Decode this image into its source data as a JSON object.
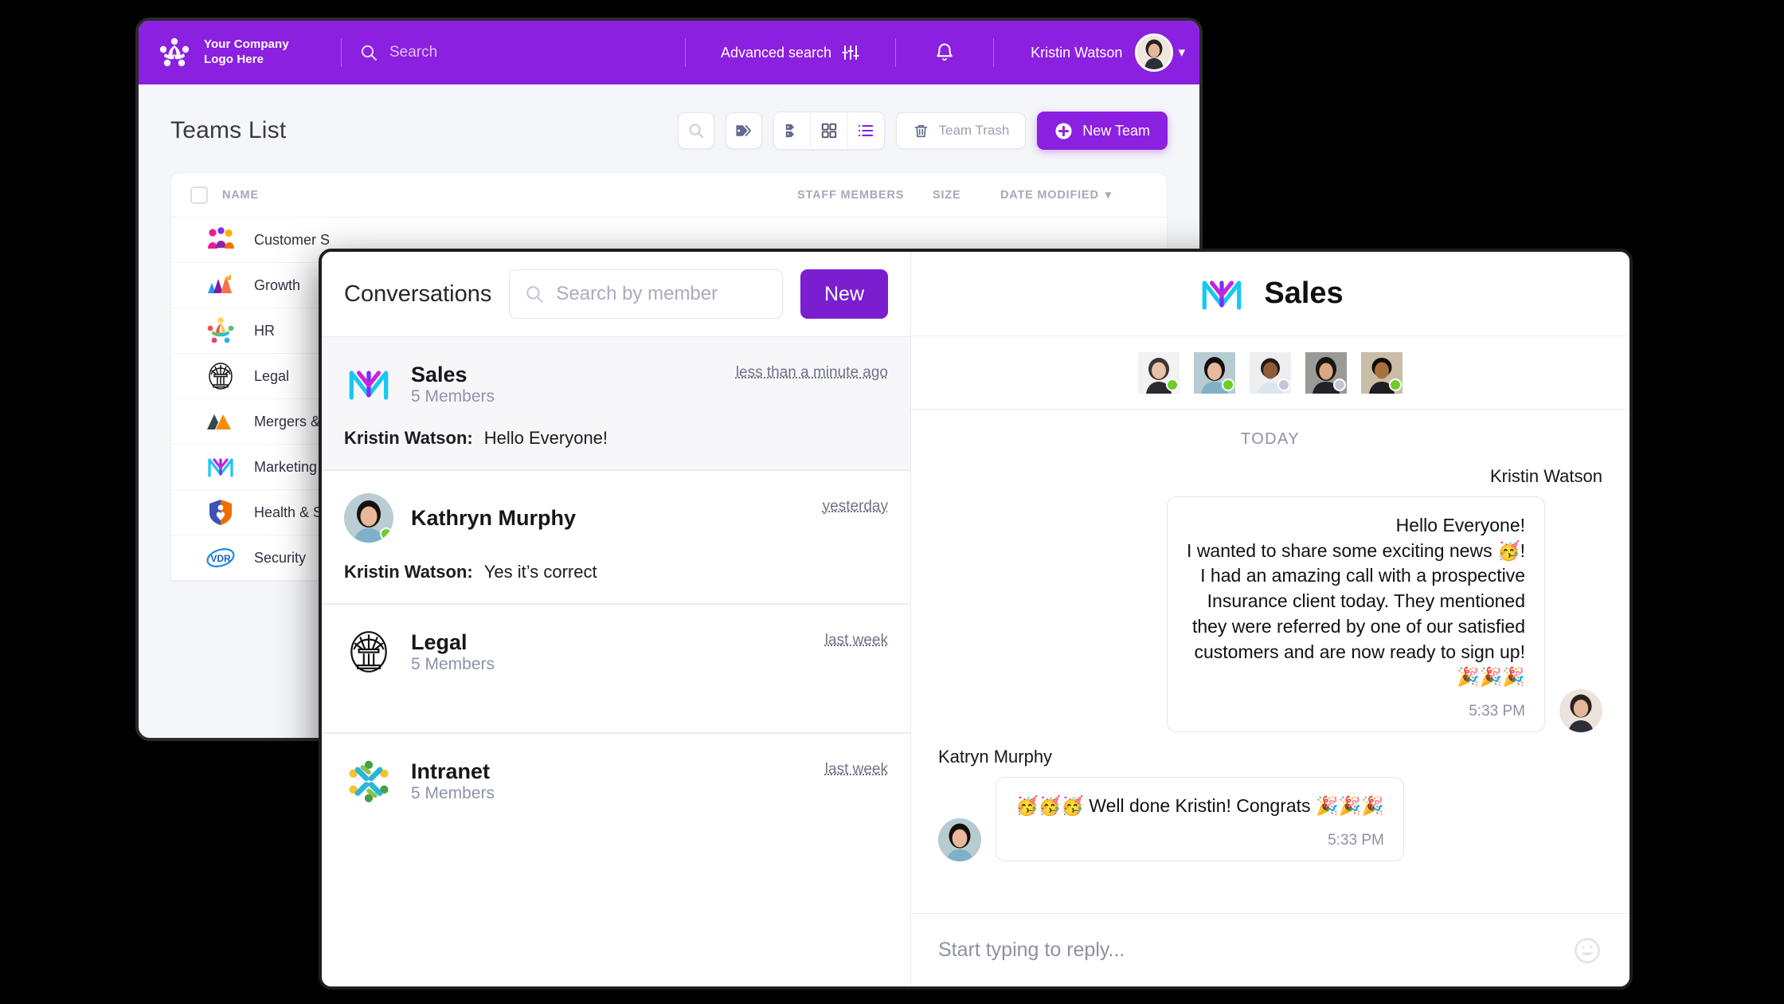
{
  "colors": {
    "brand_purple": "#8b20e0",
    "new_button_purple": "#7a1ed0",
    "online": "#6dcd2b",
    "offline": "#c5c8d4"
  },
  "app": {
    "topbar": {
      "brand_line1": "Your Company",
      "brand_line2": "Logo Here",
      "search_placeholder": "Search",
      "advanced_search_label": "Advanced search",
      "user_name": "Kristin Watson"
    },
    "page_title": "Teams List",
    "toolbar": {
      "team_trash_label": "Team Trash",
      "new_team_label": "New Team"
    },
    "table": {
      "columns": [
        "NAME",
        "STAFF MEMBERS",
        "SIZE",
        "DATE MODIFIED"
      ],
      "rows": [
        {
          "name": "Customer S"
        },
        {
          "name": "Growth"
        },
        {
          "name": "HR"
        },
        {
          "name": "Legal"
        },
        {
          "name": "Mergers & A"
        },
        {
          "name": "Marketing"
        },
        {
          "name": "Health & Sa"
        },
        {
          "name": "Security"
        }
      ]
    }
  },
  "conversations": {
    "title": "Conversations",
    "search_placeholder": "Search by member",
    "new_label": "New",
    "items": [
      {
        "name": "Sales",
        "sub": "5 Members",
        "time": "less than a minute ago",
        "preview_author": "Kristin Watson:",
        "preview_text": "Hello Everyone!",
        "type": "team",
        "active": true
      },
      {
        "name": "Kathryn Murphy",
        "sub": "",
        "time": "yesterday",
        "preview_author": "Kristin Watson:",
        "preview_text": "Yes it’s correct",
        "type": "person",
        "active": false
      },
      {
        "name": "Legal",
        "sub": "5 Members",
        "time": "last week",
        "preview_author": "",
        "preview_text": "",
        "type": "team",
        "active": false
      },
      {
        "name": "Intranet",
        "sub": "5 Members",
        "time": "last week",
        "preview_author": "",
        "preview_text": "",
        "type": "team",
        "active": false
      }
    ]
  },
  "chat": {
    "title": "Sales",
    "members_status": [
      "online",
      "online",
      "offline",
      "offline",
      "online"
    ],
    "day_divider": "TODAY",
    "messages": [
      {
        "author": "Kristin Watson",
        "text": "Hello Everyone!\nI wanted to share some exciting news 🥳!\nI had an amazing call with a prospective\nInsurance client today. They mentioned\nthey were referred by one of our satisfied\ncustomers and are now ready to sign up!\n🎉🎉🎉",
        "time": "5:33 PM",
        "outgoing": true
      },
      {
        "author": "Katryn Murphy",
        "text": "🥳🥳🥳 Well done Kristin! Congrats 🎉🎉🎉",
        "time": "5:33 PM",
        "outgoing": false
      }
    ],
    "composer_placeholder": "Start typing to reply..."
  }
}
